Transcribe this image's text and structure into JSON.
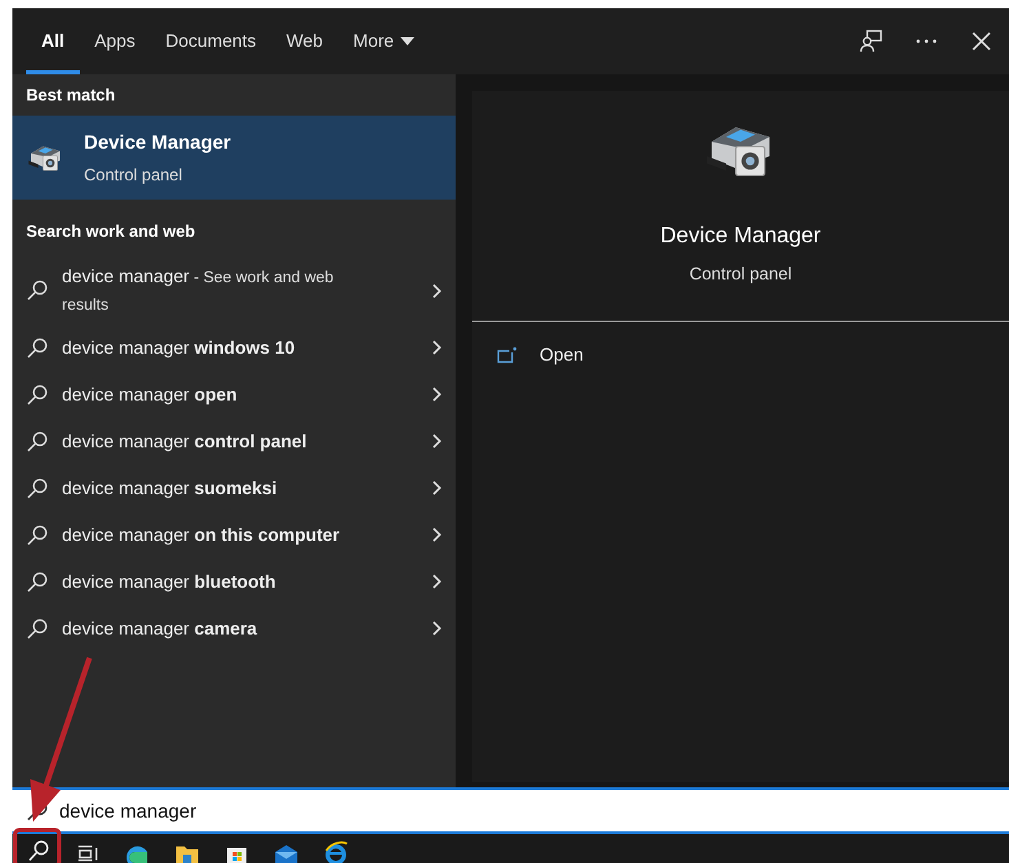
{
  "tabs": [
    {
      "label": "All",
      "selected": true
    },
    {
      "label": "Apps",
      "selected": false
    },
    {
      "label": "Documents",
      "selected": false
    },
    {
      "label": "Web",
      "selected": false
    },
    {
      "label": "More",
      "selected": false,
      "dropdown": true
    }
  ],
  "best_match": {
    "heading": "Best match",
    "title": "Device Manager",
    "subtitle": "Control panel",
    "selected": true
  },
  "web_section": {
    "heading": "Search work and web",
    "items": [
      {
        "text": "device manager",
        "note": "- See work and web results"
      },
      {
        "text": "device manager **windows 10**"
      },
      {
        "text": "device manager **open**"
      },
      {
        "text": "device manager **control panel**"
      },
      {
        "text": "device manager **suomeksi**"
      },
      {
        "text": "device manager **on this computer**"
      },
      {
        "text": "device manager **bluetooth**"
      },
      {
        "text": "device manager **camera**"
      }
    ]
  },
  "preview": {
    "title": "Device Manager",
    "subtitle": "Control panel",
    "actions": [
      {
        "label": "Open"
      }
    ]
  },
  "search": {
    "value": "device manager"
  }
}
